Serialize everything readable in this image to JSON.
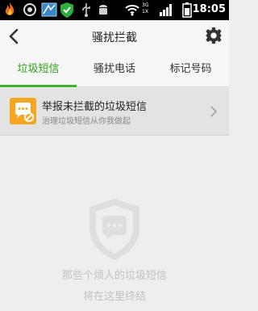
{
  "status_bar": {
    "time": "18:05",
    "network_labels": [
      "3G",
      "1X"
    ],
    "icons": [
      "flame-icon",
      "sync-icon",
      "screen-icon",
      "shield-check-icon",
      "usb-icon",
      "android-debug-icon",
      "wifi-icon",
      "signal-icon",
      "battery-icon"
    ]
  },
  "header": {
    "title": "骚扰拦截",
    "back_icon": "back-arrow-icon",
    "settings_icon": "gear-icon"
  },
  "tabs": [
    {
      "label": "垃圾短信",
      "active": true
    },
    {
      "label": "骚扰电话",
      "active": false
    },
    {
      "label": "标记号码",
      "active": false
    }
  ],
  "colors": {
    "accent": "#3cb228",
    "report_icon_bg": "#f5a623",
    "empty_text": "#c2c2c2"
  },
  "report_banner": {
    "icon": "chat-block-icon",
    "title": "举报未拦截的垃圾短信",
    "subtitle": "治理垃圾短信从你我做起"
  },
  "empty_state": {
    "icon": "shield-message-icon",
    "line1": "那些个烦人的垃圾短信",
    "line2": "将在这里终结"
  }
}
